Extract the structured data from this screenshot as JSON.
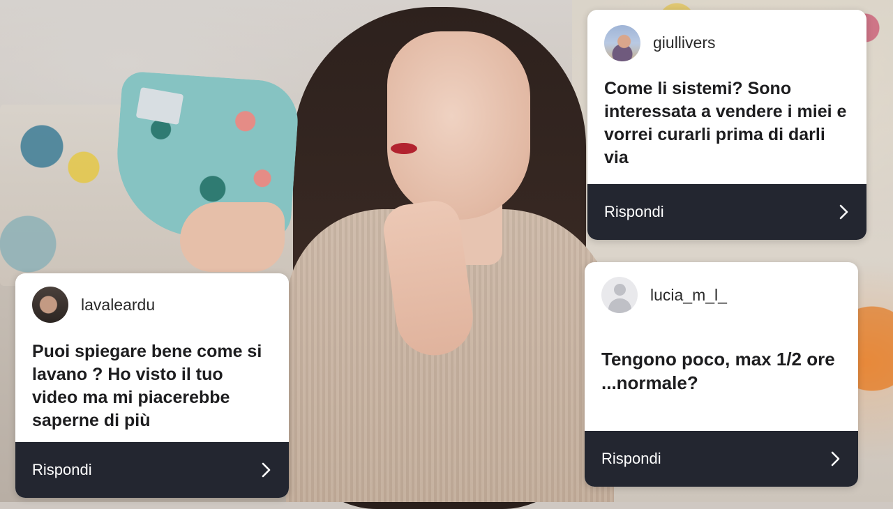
{
  "cards": [
    {
      "username": "giullivers",
      "question": "Come li sistemi? Sono interessata a vendere i miei e vorrei curarli prima di darli via",
      "reply_label": "Rispondi"
    },
    {
      "username": "lavaleardu",
      "question": "Puoi spiegare bene come si lavano ? Ho visto il tuo video ma mi piacerebbe saperne di più",
      "reply_label": "Rispondi"
    },
    {
      "username": "lucia_m_l_",
      "question": "Tengono poco, max 1/2 ore ...normale?",
      "reply_label": "Rispondi"
    }
  ],
  "icons": {
    "reply_chevron": "chevron-right-icon",
    "default_avatar": "user-placeholder-icon"
  },
  "colors": {
    "card_background": "#ffffff",
    "reply_bar": "#232630",
    "reply_text": "#ffffff",
    "question_text": "#1d1d1f"
  }
}
